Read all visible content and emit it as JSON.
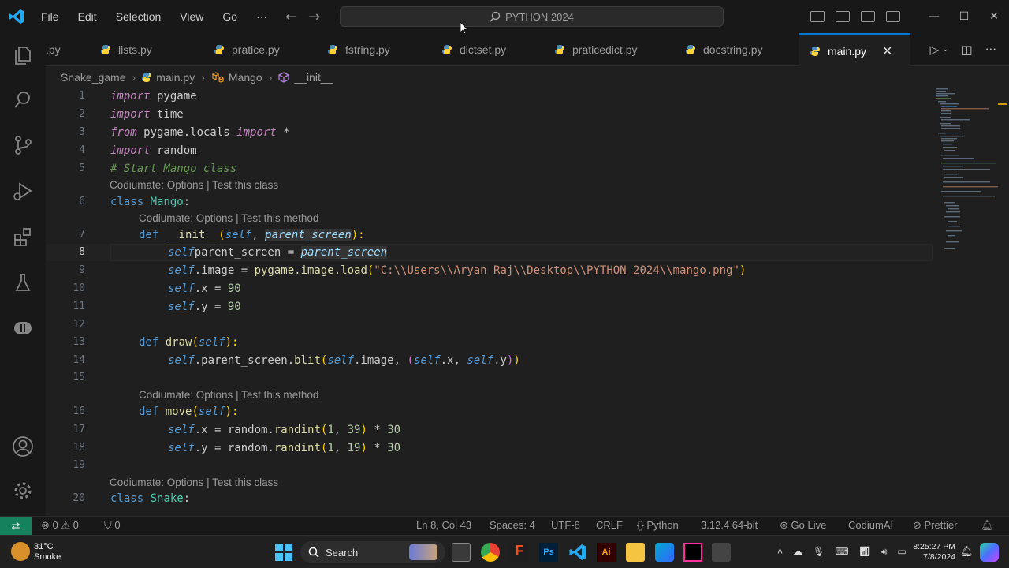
{
  "menu": {
    "file": "File",
    "edit": "Edit",
    "selection": "Selection",
    "view": "View",
    "go": "Go",
    "more": "···"
  },
  "search": {
    "text": "PYTHON 2024"
  },
  "tabs": [
    {
      "label": ".py"
    },
    {
      "label": "lists.py"
    },
    {
      "label": "pratice.py"
    },
    {
      "label": "fstring.py"
    },
    {
      "label": "dictset.py"
    },
    {
      "label": "praticedict.py"
    },
    {
      "label": "docstring.py"
    },
    {
      "label": "main.py",
      "active": true
    }
  ],
  "breadcrumb": {
    "folder": "Snake_game",
    "file": "main.py",
    "cls": "Mango",
    "method": "__init__"
  },
  "codelens": {
    "options": "Codiumate: Options",
    "sep": " | ",
    "test_class": "Test this class",
    "test_method": "Test this method"
  },
  "code": {
    "l1a": "import",
    "l1b": " pygame",
    "l2a": "import",
    "l2b": " time",
    "l3a": "from",
    "l3b": " pygame.locals ",
    "l3c": "import",
    "l3d": " *",
    "l4a": "import",
    "l4b": " random",
    "l5": "# Start Mango class",
    "l6a": "class",
    "l6b": " Mango",
    ":": ":",
    "l7a": "def",
    "l7b": " __init__",
    "l7c": "(",
    "l7d": "self",
    ",": ", ",
    "l7e": "parent_screen",
    "l7f": "):",
    "l8a": "self",
    ".": ".",
    "l8b": "parent_screen = ",
    "l8c": "parent_screen",
    "l9a": "self",
    "l9b": ".image = ",
    "l9c": "pygame.image.",
    "l9d": "load",
    "l9e": "(",
    "l9f": "\"C:\\\\Users\\\\Aryan Raj\\\\Desktop\\\\PYTHON 2024\\\\mango.png\"",
    "l9g": ")",
    "l10a": "self",
    "l10b": ".x = ",
    "l10c": "90",
    "l11a": "self",
    "l11b": ".y = ",
    "l11c": "90",
    "l13a": "def",
    "l13b": " draw",
    "l13c": "(",
    "l13d": "self",
    "l13e": "):",
    "l14a": "self",
    "l14b": ".parent_screen.",
    "l14c": "blit",
    "l14d": "(",
    "l14e": "self",
    "l14f": ".image, ",
    "l14g": "(",
    "l14h": "self",
    "l14i": ".x, ",
    "l14j": "self",
    "l14k": ".y",
    "l14l": ")",
    "l14m": ")",
    "l16a": "def",
    "l16b": " move",
    "l16c": "(",
    "l16d": "self",
    "l16e": "):",
    "l17a": "self",
    "l17b": ".x = random.",
    "l17c": "randint",
    "l17d": "(",
    "l17e": "1",
    "l17f": "39",
    "l17g": ")",
    " *": " * ",
    "l17h": "30",
    "l18a": "self",
    "l18b": ".y = random.",
    "l18c": "randint",
    "l18d": "(",
    "l18e": "1",
    "l18f": "19",
    "l18g": ")",
    "l18h": "30",
    "l20a": "class",
    "l20b": " Snake",
    ":2": ":"
  },
  "line_numbers": [
    "1",
    "2",
    "3",
    "4",
    "5",
    "6",
    "7",
    "8",
    "9",
    "10",
    "11",
    "12",
    "13",
    "14",
    "15",
    "16",
    "17",
    "18",
    "19",
    "20"
  ],
  "status": {
    "errors": "0",
    "warnings": "0",
    "ports": "0",
    "position": "Ln 8, Col 43",
    "spaces": "Spaces: 4",
    "encoding": "UTF-8",
    "eol": "CRLF",
    "language": "Python",
    "version": "3.12.4 64-bit",
    "golive": "Go Live",
    "codium": "CodiumAI",
    "prettier": "Prettier"
  },
  "taskbar": {
    "temp": "31°C",
    "weather": "Smoke",
    "search": "Search",
    "time": "8:25:27 PM",
    "date": "7/8/2024"
  },
  "colors": {
    "accent": "#0078d4",
    "remote": "#16825d",
    "keyword": "#c586c0",
    "string": "#ce9178",
    "number": "#b5cea8",
    "self": "#569cd6",
    "function": "#dcdcaa"
  }
}
